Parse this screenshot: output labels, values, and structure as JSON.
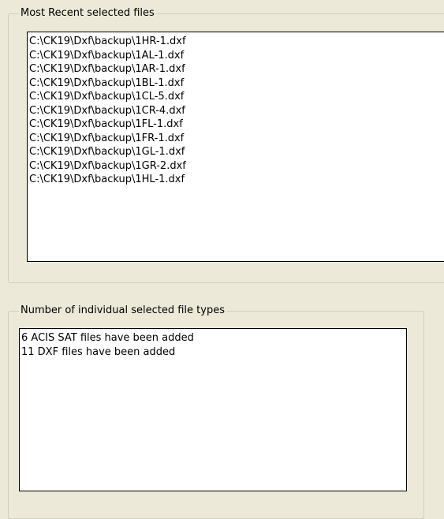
{
  "recent_group": {
    "title": "Most Recent selected files",
    "files": [
      "C:\\CK19\\Dxf\\backup\\1HR-1.dxf",
      "C:\\CK19\\Dxf\\backup\\1AL-1.dxf",
      "C:\\CK19\\Dxf\\backup\\1AR-1.dxf",
      "C:\\CK19\\Dxf\\backup\\1BL-1.dxf",
      "C:\\CK19\\Dxf\\backup\\1CL-5.dxf",
      "C:\\CK19\\Dxf\\backup\\1CR-4.dxf",
      "C:\\CK19\\Dxf\\backup\\1FL-1.dxf",
      "C:\\CK19\\Dxf\\backup\\1FR-1.dxf",
      "C:\\CK19\\Dxf\\backup\\1GL-1.dxf",
      "C:\\CK19\\Dxf\\backup\\1GR-2.dxf",
      "C:\\CK19\\Dxf\\backup\\1HL-1.dxf"
    ]
  },
  "types_group": {
    "title": "Number of individual selected file types",
    "entries": [
      "6 ACIS SAT files have been added",
      "11 DXF files have been added"
    ]
  }
}
